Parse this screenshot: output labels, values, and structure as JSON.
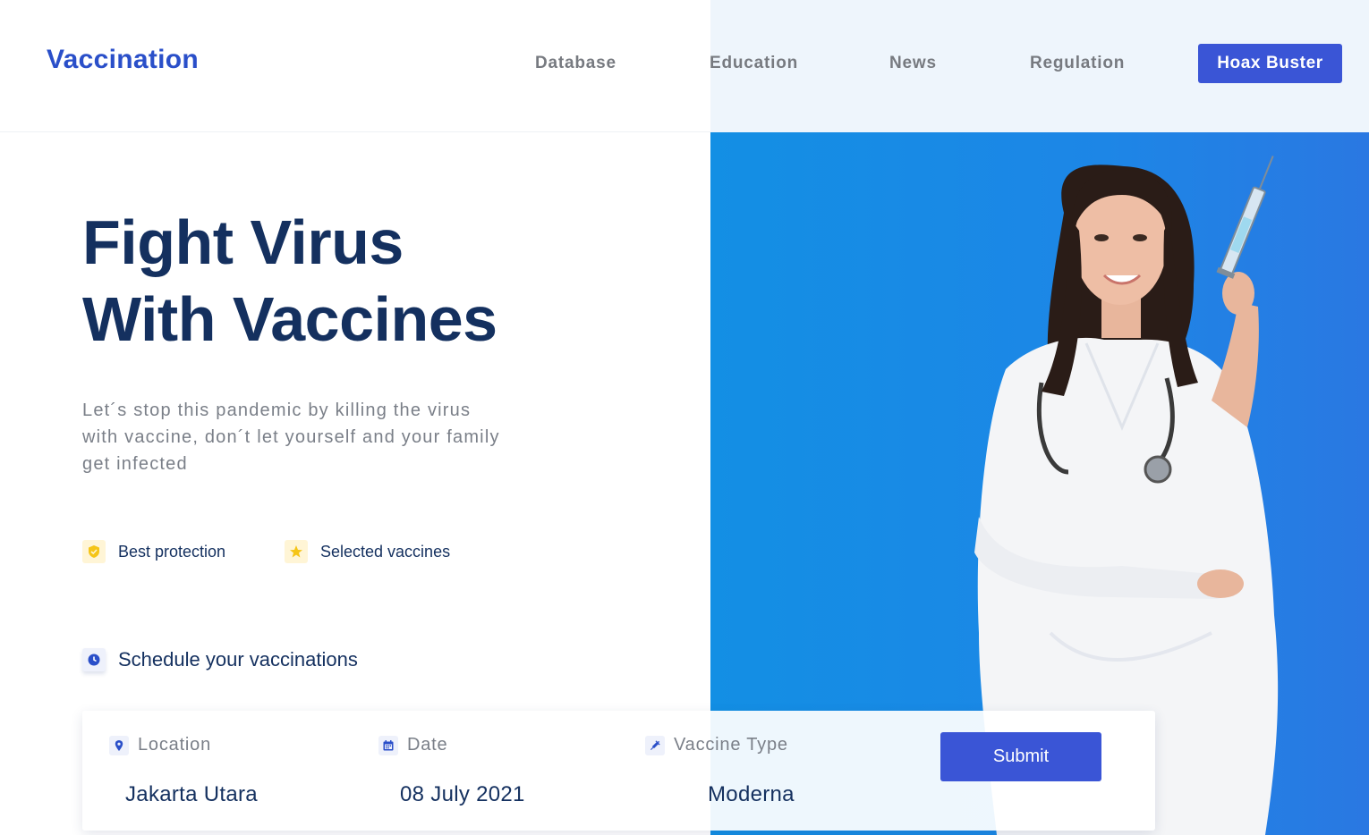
{
  "nav": {
    "logo": "Vaccination",
    "links": [
      "Database",
      "Education",
      "News",
      "Regulation"
    ],
    "cta": "Hoax Buster"
  },
  "hero": {
    "title_line1": "Fight Virus",
    "title_line2": "With Vaccines",
    "subtitle": "Let´s stop this pandemic by killing the virus with vaccine, don´t let yourself and your family get infected",
    "features": [
      {
        "icon": "shield-check-icon",
        "label": "Best protection"
      },
      {
        "icon": "star-icon",
        "label": "Selected vaccines"
      }
    ],
    "image": "doctor-holding-syringe"
  },
  "schedule": {
    "icon": "clock-icon",
    "heading": "Schedule your vaccinations"
  },
  "form": {
    "fields": [
      {
        "icon": "location-pin-icon",
        "label": "Location",
        "value": "Jakarta Utara"
      },
      {
        "icon": "calendar-icon",
        "label": "Date",
        "value": "08 July 2021"
      },
      {
        "icon": "syringe-icon",
        "label": "Vaccine Type",
        "value": "Moderna"
      }
    ],
    "submit": "Submit"
  },
  "colors": {
    "primary": "#3a55d6",
    "heading": "#14305f",
    "hero_panel": "#1d86e6",
    "nav_tint": "#eef5fc",
    "feature_icon_bg": "#fff5d6"
  }
}
